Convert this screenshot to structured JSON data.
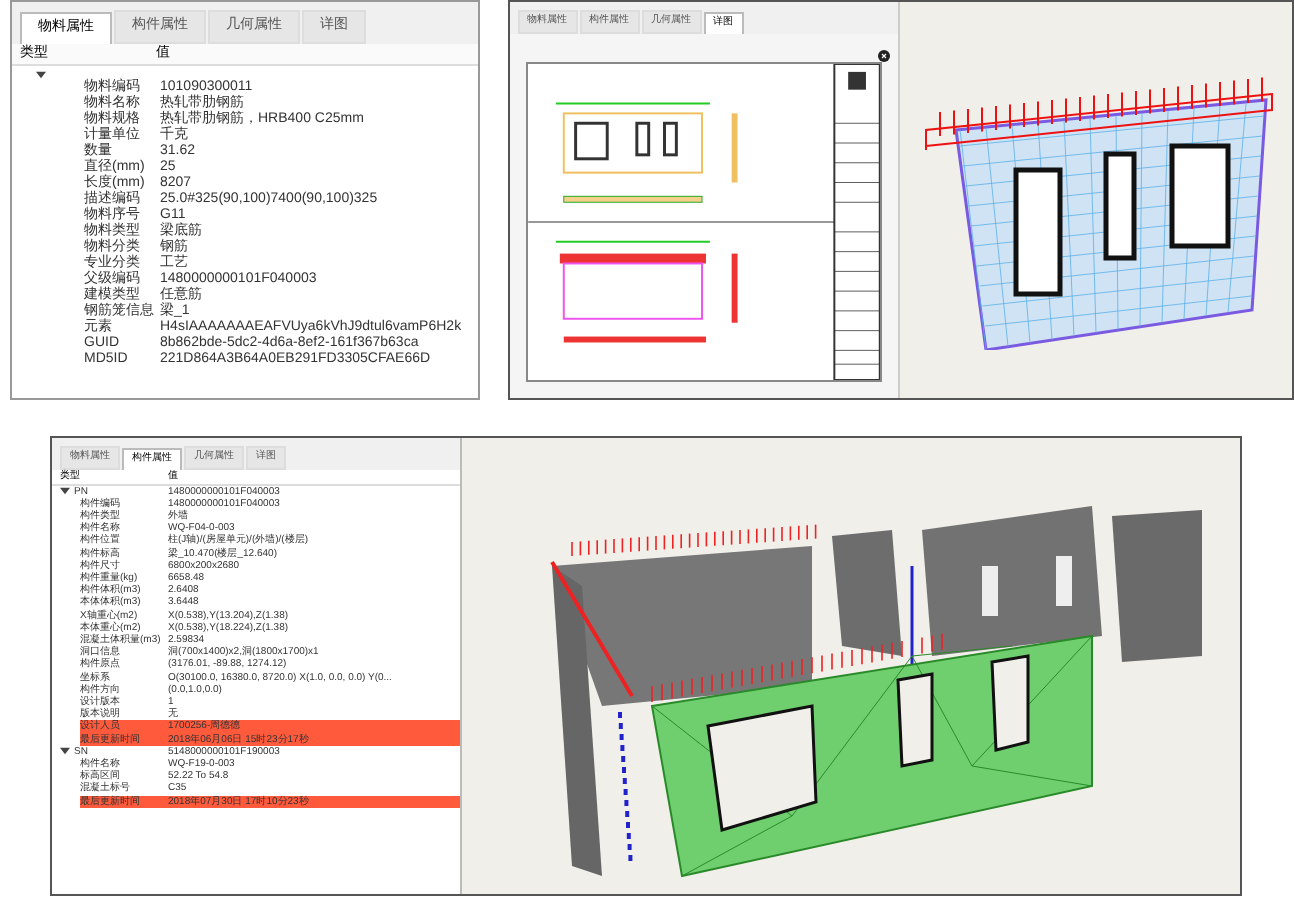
{
  "figure_a": {
    "tabs": [
      {
        "label": "物料属性",
        "selected": true
      },
      {
        "label": "构件属性",
        "selected": false
      },
      {
        "label": "几何属性",
        "selected": false
      },
      {
        "label": "详图",
        "selected": false
      }
    ],
    "columns": [
      "类型",
      "值"
    ],
    "tree": {
      "expanded": true,
      "rows": [
        {
          "name": "物料编码",
          "value": "101090300011"
        },
        {
          "name": "物料名称",
          "value": "热轧带肋钢筋"
        },
        {
          "name": "物料规格",
          "value": "热轧带肋钢筋，HRB400 C25mm"
        },
        {
          "name": "计量单位",
          "value": "千克"
        },
        {
          "name": "数量",
          "value": "31.62"
        },
        {
          "name": "直径(mm)",
          "value": "25"
        },
        {
          "name": "长度(mm)",
          "value": "8207"
        },
        {
          "name": "描述编码",
          "value": "25.0#325(90,100)7400(90,100)325"
        },
        {
          "name": "物料序号",
          "value": "G11"
        },
        {
          "name": "物料类型",
          "value": "梁底筋"
        },
        {
          "name": "物料分类",
          "value": "钢筋"
        },
        {
          "name": "专业分类",
          "value": "工艺"
        },
        {
          "name": "父级编码",
          "value": "1480000000101F040003"
        },
        {
          "name": "建模类型",
          "value": "任意筋"
        },
        {
          "name": "钢筋笼信息",
          "value": "梁_1"
        },
        {
          "name": "元素",
          "value": "H4sIAAAAAAAEAFVUya6kVhJ9dtul6vamP6H2k"
        },
        {
          "name": "GUID",
          "value": "8b862bde-5dc2-4d6a-8ef2-161f367b63ca"
        },
        {
          "name": "MD5ID",
          "value": "221D864A3B64A0EB291FD3305CFAE66D"
        }
      ]
    }
  },
  "figure_b": {
    "tabs": [
      {
        "label": "物料属性",
        "selected": false
      },
      {
        "label": "构件属性",
        "selected": false
      },
      {
        "label": "几何属性",
        "selected": false
      },
      {
        "label": "详图",
        "selected": true
      }
    ]
  },
  "figure_c": {
    "tabs": [
      {
        "label": "物料属性",
        "selected": false
      },
      {
        "label": "构件属性",
        "selected": true
      },
      {
        "label": "几何属性",
        "selected": false
      },
      {
        "label": "详图",
        "selected": false
      }
    ],
    "columns": [
      "类型",
      "值"
    ],
    "groups": [
      {
        "name": "PN",
        "value": "1480000000101F040003",
        "expanded": true,
        "children": [
          {
            "name": "构件编码",
            "value": "1480000000101F040003",
            "highlighted": false
          },
          {
            "name": "构件类型",
            "value": "外墙",
            "highlighted": false
          },
          {
            "name": "构件名称",
            "value": "WQ-F04-0-003",
            "highlighted": false
          },
          {
            "name": "构件位置",
            "value": "柱(J轴)/(房屋单元)/(外墙)/(楼层)",
            "highlighted": false
          },
          {
            "name": "构件标高",
            "value": "梁_10.470(楼层_12.640)",
            "highlighted": false
          },
          {
            "name": "构件尺寸",
            "value": "6800x200x2680",
            "highlighted": false
          },
          {
            "name": "构件重量(kg)",
            "value": "6658.48",
            "highlighted": false
          },
          {
            "name": "构件体积(m3)",
            "value": "2.6408",
            "highlighted": false
          },
          {
            "name": "本体体积(m3)",
            "value": "3.6448",
            "highlighted": false
          },
          {
            "name": "X轴重心(m2)",
            "value": "X(0.538),Y(13.204),Z(1.38)",
            "highlighted": false
          },
          {
            "name": "本体重心(m2)",
            "value": "X(0.538),Y(18.224),Z(1.38)",
            "highlighted": false
          },
          {
            "name": "混凝土体积量(m3)",
            "value": "2.59834",
            "highlighted": false
          },
          {
            "name": "洞口信息",
            "value": "洞(700x1400)x2,洞(1800x1700)x1",
            "highlighted": false
          },
          {
            "name": "构件原点",
            "value": "(3176.01, -89.88, 1274.12)",
            "highlighted": false
          },
          {
            "name": "坐标系",
            "value": "O(30100.0, 16380.0, 8720.0) X(1.0, 0.0, 0.0) Y(0...",
            "highlighted": false
          },
          {
            "name": "构件方向",
            "value": "(0.0,1.0,0.0)",
            "highlighted": false
          },
          {
            "name": "设计版本",
            "value": "1",
            "highlighted": false
          },
          {
            "name": "版本说明",
            "value": "无",
            "highlighted": false
          },
          {
            "name": "设计人员",
            "value": "1700256-周德德",
            "highlighted": true
          },
          {
            "name": "最后更新时间",
            "value": "2018年06月06日 15时23分17秒",
            "highlighted": true
          }
        ]
      },
      {
        "name": "SN",
        "value": "5148000000101F190003",
        "expanded": true,
        "children": [
          {
            "name": "构件名称",
            "value": "WQ-F19-0-003",
            "highlighted": false
          },
          {
            "name": "标高区间",
            "value": "52.22 To 54.8",
            "highlighted": false
          },
          {
            "name": "混凝土标号",
            "value": "C35",
            "highlighted": false
          },
          {
            "name": "最后更新时间",
            "value": "2018年07月30日 17时10分23秒",
            "highlighted": true
          }
        ]
      }
    ]
  }
}
